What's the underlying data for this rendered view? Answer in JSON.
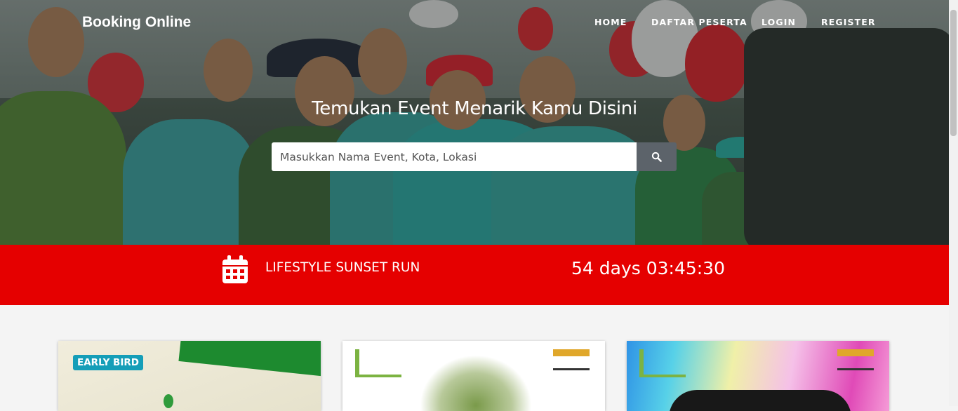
{
  "navbar": {
    "brand": "Booking Online",
    "links": [
      "HOME",
      "DAFTAR PESERTA",
      "LOGIN",
      "REGISTER"
    ]
  },
  "hero": {
    "title": "Temukan Event Menarik Kamu Disini",
    "search_placeholder": "Masukkan Nama Event, Kota, Lokasi",
    "search_icon": "search-icon"
  },
  "featured_event": {
    "icon": "calendar-icon",
    "name": "LIFESTYLE SUNSET RUN",
    "countdown": "54 days 03:45:30"
  },
  "event_cards": [
    {
      "badge": "EARLY BIRD"
    },
    {
      "badge": ""
    },
    {
      "badge": ""
    }
  ],
  "colors": {
    "band": "#e50000",
    "badge": "#159eb8",
    "search_button": "#5c636a"
  }
}
